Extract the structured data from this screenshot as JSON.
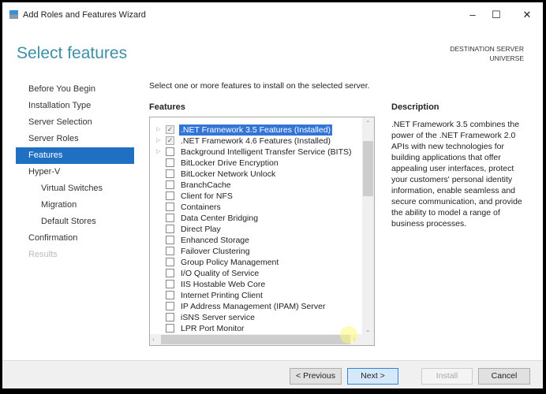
{
  "window": {
    "title": "Add Roles and Features Wizard",
    "minimize": "–",
    "maximize": "☐",
    "close": "✕"
  },
  "header": {
    "title": "Select features",
    "destination_label": "DESTINATION SERVER",
    "destination_value": "UNIVERSE"
  },
  "nav": [
    {
      "label": "Before You Begin",
      "state": "normal"
    },
    {
      "label": "Installation Type",
      "state": "normal"
    },
    {
      "label": "Server Selection",
      "state": "normal"
    },
    {
      "label": "Server Roles",
      "state": "normal"
    },
    {
      "label": "Features",
      "state": "active"
    },
    {
      "label": "Hyper-V",
      "state": "normal"
    },
    {
      "label": "Virtual Switches",
      "state": "sub"
    },
    {
      "label": "Migration",
      "state": "sub"
    },
    {
      "label": "Default Stores",
      "state": "sub"
    },
    {
      "label": "Confirmation",
      "state": "normal"
    },
    {
      "label": "Results",
      "state": "disabled"
    }
  ],
  "main": {
    "intro": "Select one or more features to install on the selected server.",
    "features_label": "Features",
    "features": [
      {
        "label": ".NET Framework 3.5 Features (Installed)",
        "checked": true,
        "expandable": true,
        "selected": true
      },
      {
        "label": ".NET Framework 4.6 Features (Installed)",
        "checked": true,
        "expandable": true
      },
      {
        "label": "Background Intelligent Transfer Service (BITS)",
        "checked": false,
        "expandable": true
      },
      {
        "label": "BitLocker Drive Encryption",
        "checked": false
      },
      {
        "label": "BitLocker Network Unlock",
        "checked": false
      },
      {
        "label": "BranchCache",
        "checked": false
      },
      {
        "label": "Client for NFS",
        "checked": false
      },
      {
        "label": "Containers",
        "checked": false
      },
      {
        "label": "Data Center Bridging",
        "checked": false
      },
      {
        "label": "Direct Play",
        "checked": false
      },
      {
        "label": "Enhanced Storage",
        "checked": false
      },
      {
        "label": "Failover Clustering",
        "checked": false
      },
      {
        "label": "Group Policy Management",
        "checked": false
      },
      {
        "label": "I/O Quality of Service",
        "checked": false
      },
      {
        "label": "IIS Hostable Web Core",
        "checked": false
      },
      {
        "label": "Internet Printing Client",
        "checked": false
      },
      {
        "label": "IP Address Management (IPAM) Server",
        "checked": false
      },
      {
        "label": "iSNS Server service",
        "checked": false
      },
      {
        "label": "LPR Port Monitor",
        "checked": false
      }
    ],
    "description_label": "Description",
    "description": ".NET Framework 3.5 combines the power of the .NET Framework 2.0 APIs with new technologies for building applications that offer appealing user interfaces, protect your customers' personal identity information, enable seamless and secure communication, and provide the ability to model a range of business processes."
  },
  "footer": {
    "previous": "< Previous",
    "next": "Next >",
    "install": "Install",
    "cancel": "Cancel"
  }
}
